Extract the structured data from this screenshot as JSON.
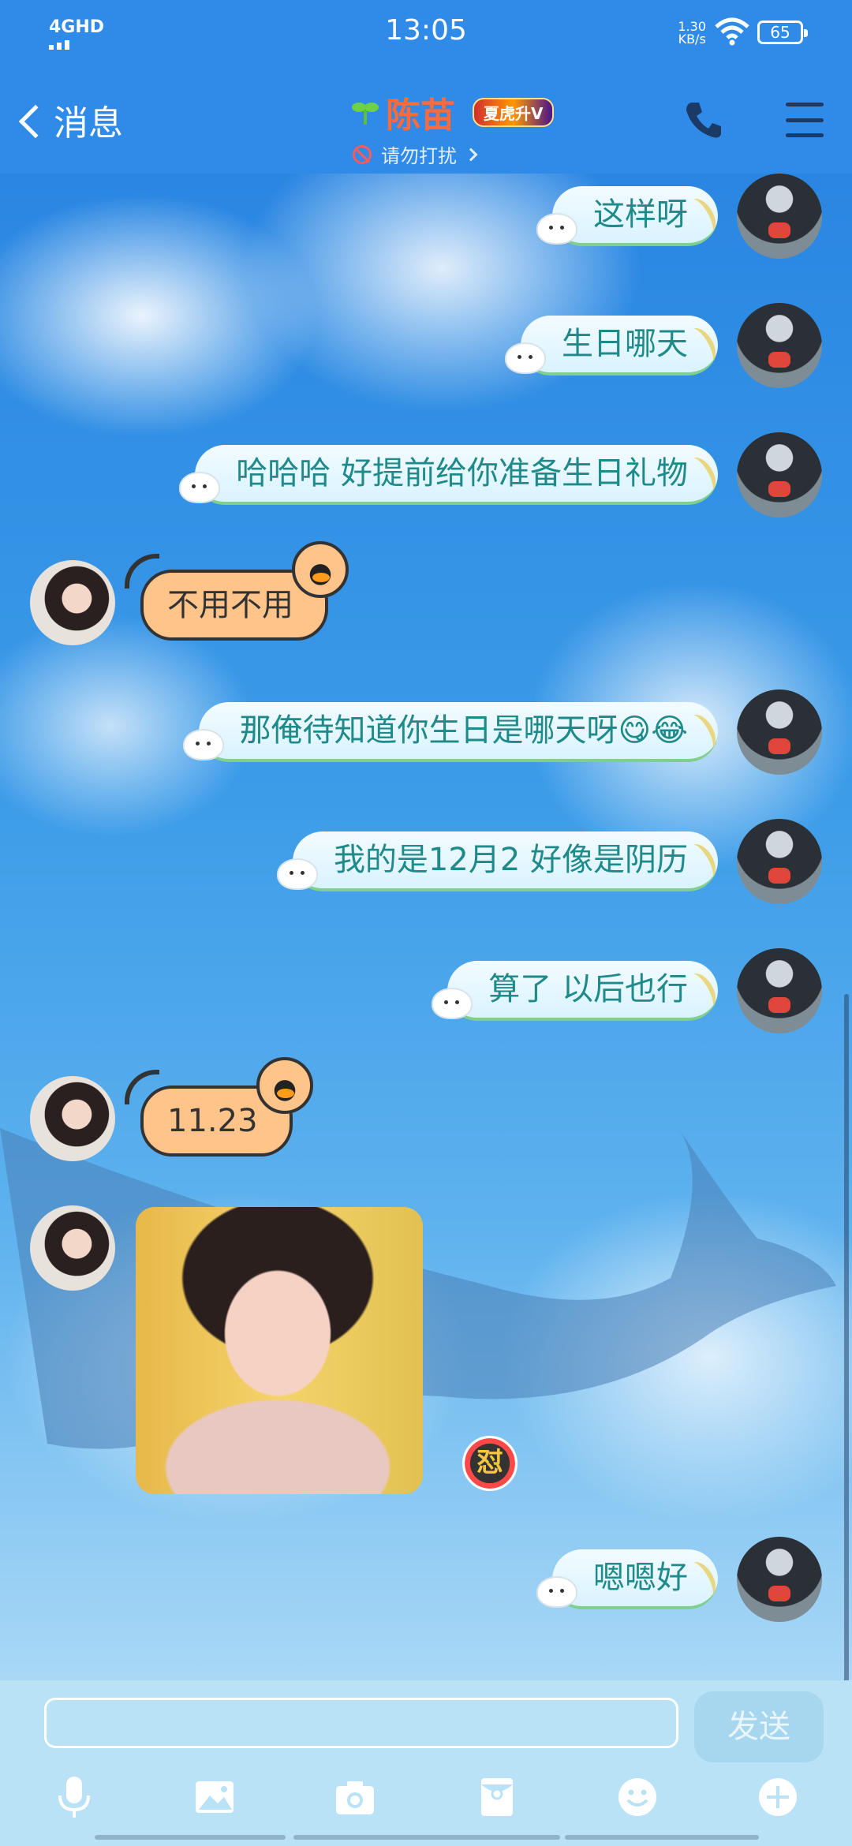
{
  "status_bar": {
    "network": "4GHD",
    "time": "13:05",
    "speed_value": "1.30",
    "speed_unit": "KB/s",
    "battery": "65"
  },
  "header": {
    "back_label": "消息",
    "contact_name": "陈苗",
    "vip_badge": "夏虎升V",
    "status_text": "请勿打扰",
    "name_color": "#ff6a3a",
    "icons": [
      "back-chevron",
      "sprout",
      "do-not-disturb",
      "phone",
      "menu"
    ]
  },
  "messages": [
    {
      "from": "me",
      "text": "这样呀"
    },
    {
      "from": "me",
      "text": "生日哪天"
    },
    {
      "from": "me",
      "text": "哈哈哈  好提前给你准备生日礼物"
    },
    {
      "from": "her",
      "text": "不用不用"
    },
    {
      "from": "me",
      "text": "那俺待知道你生日是哪天呀😋😂"
    },
    {
      "from": "me",
      "text": "我的是12月2   好像是阴历"
    },
    {
      "from": "me",
      "text": "算了 以后也行"
    },
    {
      "from": "her",
      "text": "11.23"
    },
    {
      "from": "her",
      "type": "image",
      "text": ""
    },
    {
      "from": "me",
      "text": "嗯嗯好"
    }
  ],
  "reaction_icon": "怼",
  "input": {
    "placeholder": "",
    "value": "",
    "send_label": "发送"
  },
  "toolbar": [
    "microphone-icon",
    "image-icon",
    "camera-icon",
    "red-packet-icon",
    "emoji-icon",
    "plus-icon"
  ]
}
